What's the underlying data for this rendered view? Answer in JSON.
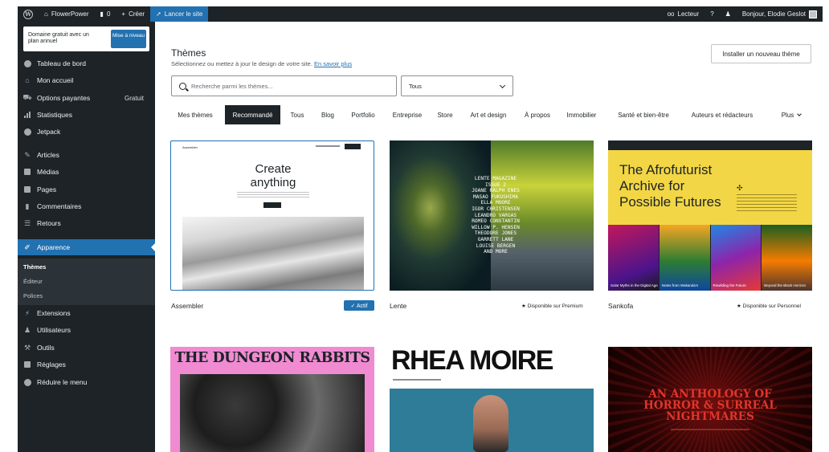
{
  "adminbar": {
    "site_name": "FlowerPower",
    "comments_count": "0",
    "create_label": "Créer",
    "launch_label": "Lancer le site",
    "reader_label": "Lecteur",
    "greeting": "Bonjour, Elodie Geslot"
  },
  "sidebar": {
    "upsell_text": "Domaine gratuit avec un plan annuel",
    "upsell_button": "Mise à niveau",
    "items": [
      {
        "label": "Tableau de bord",
        "icon": "dashboard-icon"
      },
      {
        "label": "Mon accueil",
        "icon": "home-icon"
      },
      {
        "label": "Options payantes",
        "icon": "cart-icon",
        "badge": "Gratuit"
      },
      {
        "label": "Statistiques",
        "icon": "stats-icon"
      },
      {
        "label": "Jetpack",
        "icon": "jetpack-icon"
      },
      {
        "label": "Articles",
        "icon": "pin-icon"
      },
      {
        "label": "Médias",
        "icon": "media-icon"
      },
      {
        "label": "Pages",
        "icon": "page-icon"
      },
      {
        "label": "Commentaires",
        "icon": "comment-icon"
      },
      {
        "label": "Retours",
        "icon": "feedback-icon"
      },
      {
        "label": "Apparence",
        "icon": "brush-icon"
      },
      {
        "label": "Extensions",
        "icon": "plugin-icon"
      },
      {
        "label": "Utilisateurs",
        "icon": "users-icon"
      },
      {
        "label": "Outils",
        "icon": "tools-icon"
      },
      {
        "label": "Réglages",
        "icon": "settings-icon"
      },
      {
        "label": "Réduire le menu",
        "icon": "collapse-icon"
      }
    ],
    "submenu": [
      "Thèmes",
      "Éditeur",
      "Polices"
    ]
  },
  "main": {
    "title": "Thèmes",
    "subtitle": "Sélectionnez ou mettez à jour le design de votre site.",
    "learn_more": "En savoir plus",
    "install_button": "Installer un nouveau thème",
    "search_placeholder": "Recherche parmi les thèmes...",
    "filter_value": "Tous",
    "tabs": [
      "Mes thèmes",
      "Recommandé",
      "Tous",
      "Blog",
      "Portfolio",
      "Entreprise",
      "Store",
      "Art et design",
      "À propos",
      "Immobilier",
      "Santé et bien-être",
      "Auteurs et rédacteurs",
      "Plus"
    ]
  },
  "themes": [
    {
      "name": "Assembler",
      "status": "✓ Actif",
      "preview_heading": "Create anything",
      "preview_brand": "Assembler"
    },
    {
      "name": "Lente",
      "status": "★ Disponible sur Premium",
      "preview_text": "LENTE MAGAZINE\nISSUE 2\nJOANE RALPH ENES\nMASAO FUKUSHIMA\nELLA MOORE\nIGOR CHRISTENSEN\nLEANDRO VARGAS\nROMEO CONSTANTIN\nWILLOW P. HENSEN\nTHEODORE JONES\nGARRETT LANE\nLOUISE BERGEN\nAND MORE"
    },
    {
      "name": "Sankofa",
      "status": "★ Disponible sur Personnel",
      "preview_heading": "The Afrofuturist Archive for Possible Futures",
      "tiles": [
        "Solar Myths in the Digital Age",
        "Notes from Wakanda's",
        "Rewilding the Future",
        "Beyond the Black Horizon"
      ]
    },
    {
      "name": "",
      "preview_heading": "THE DUNGEON RABBITS"
    },
    {
      "name": "",
      "preview_heading": "RHEA MOIRE"
    },
    {
      "name": "",
      "preview_heading": "AN ANTHOLOGY OF HORROR & SURREAL NIGHTMARES"
    }
  ]
}
